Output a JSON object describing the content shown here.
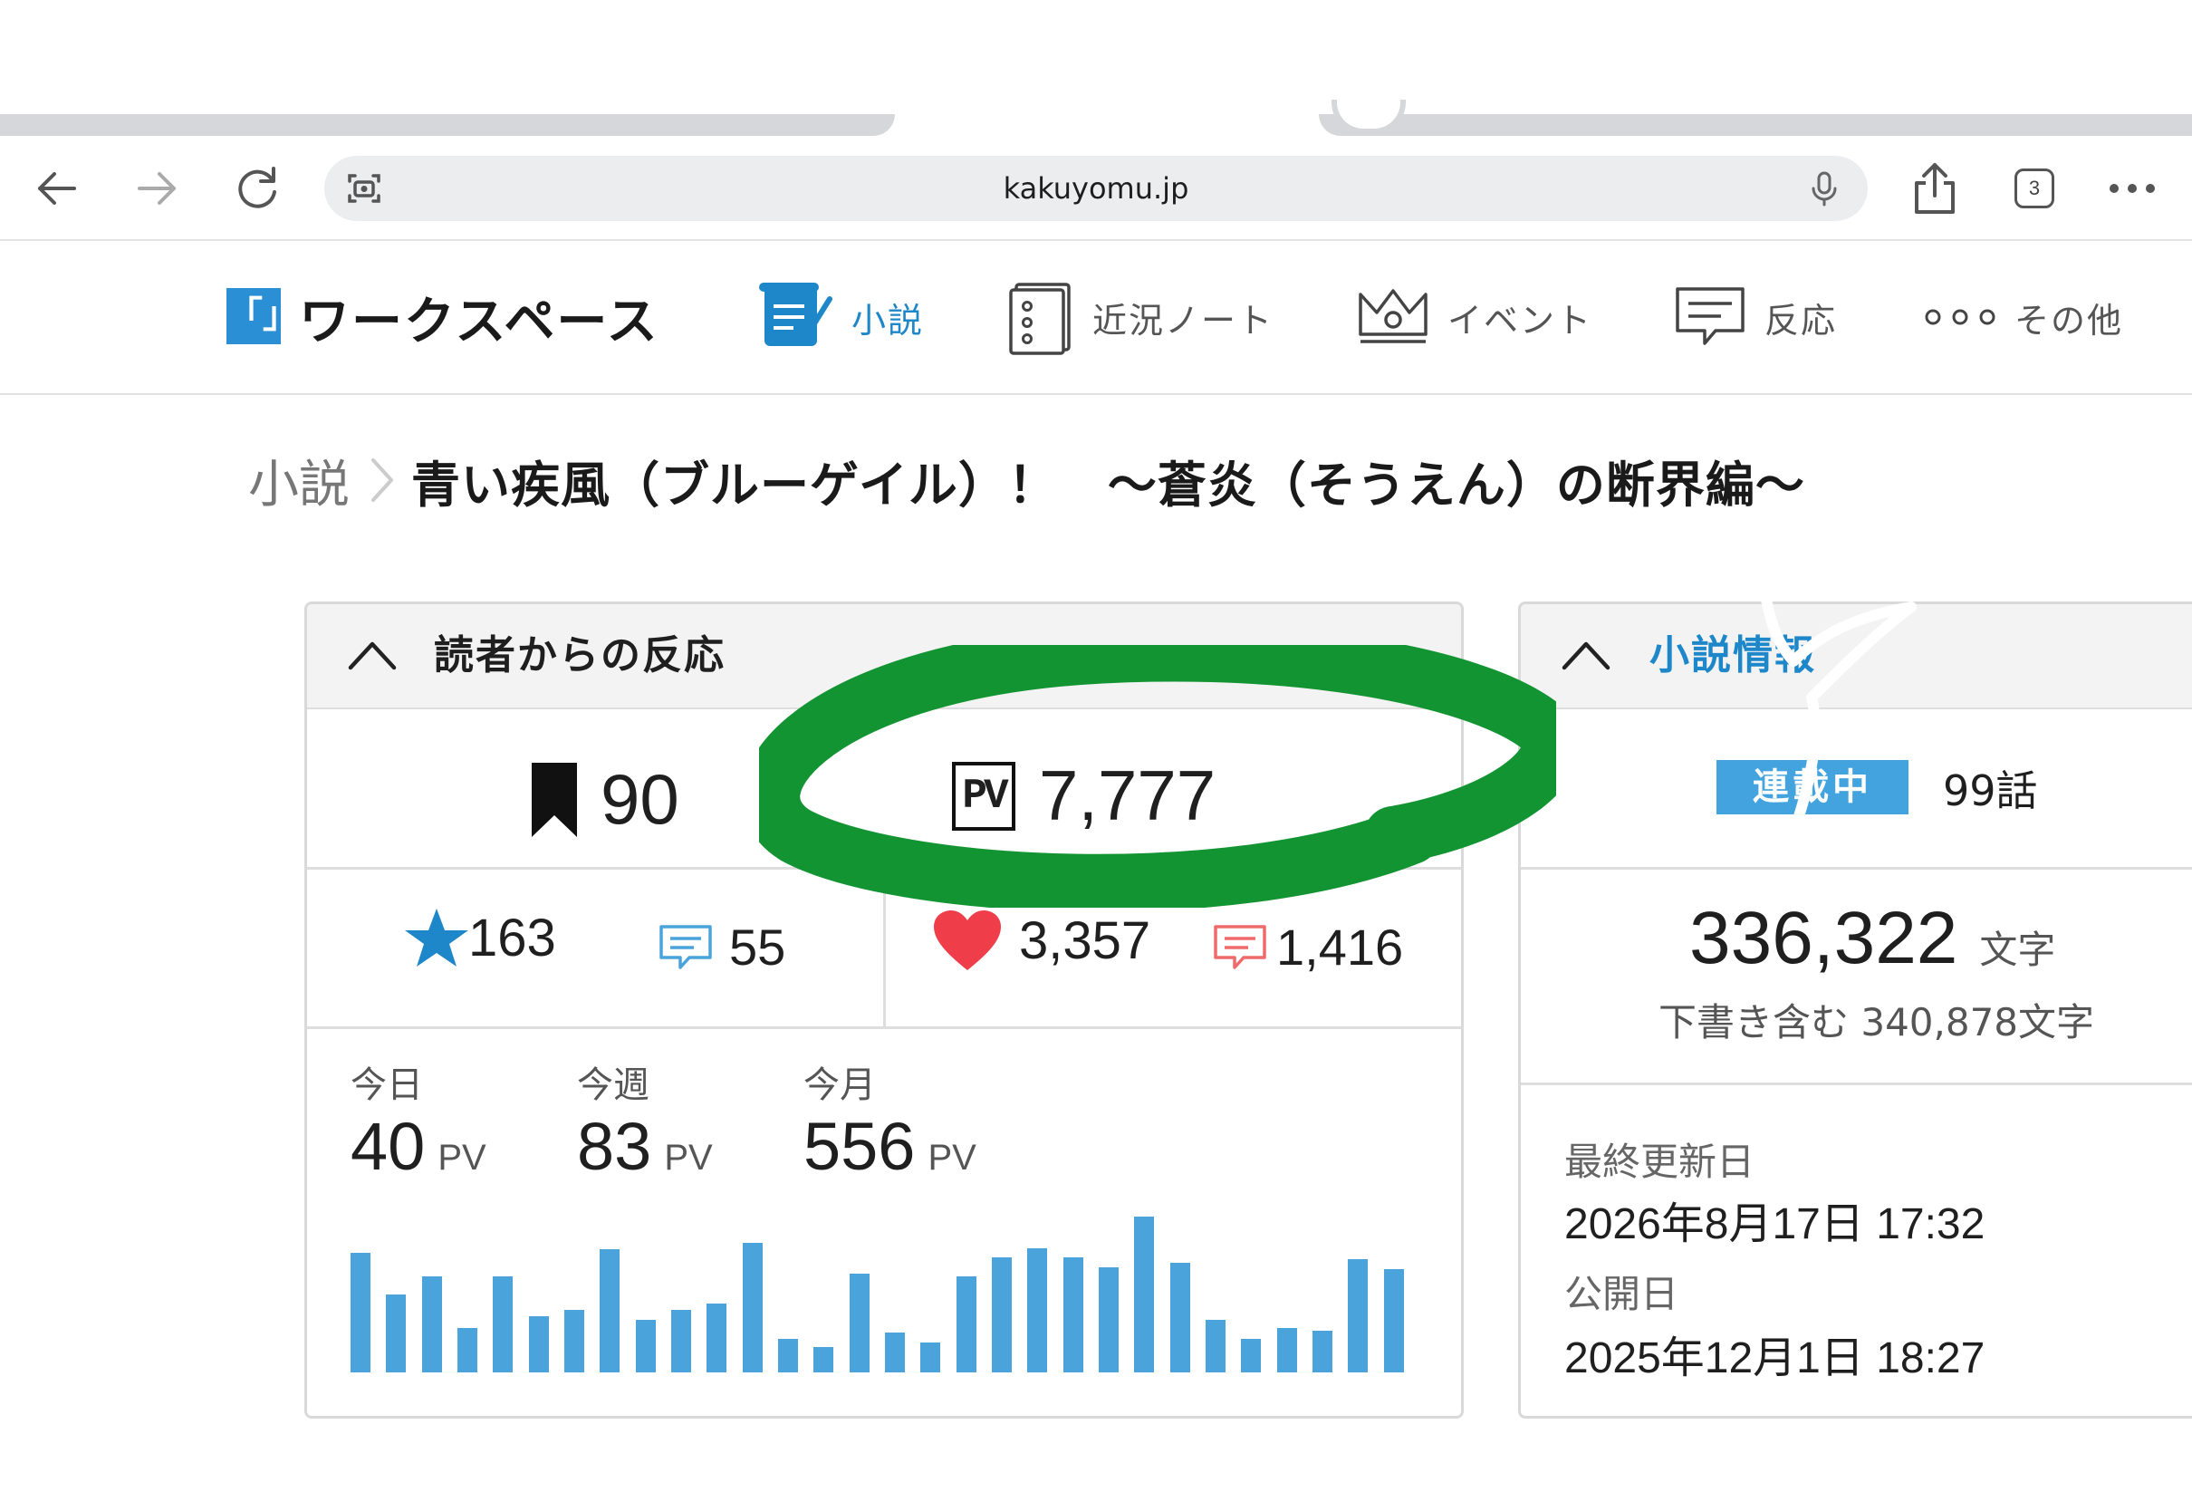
{
  "browser": {
    "url": "kakuyomu.jp",
    "tab_count": "3"
  },
  "header": {
    "logo_text": "「」",
    "title": "ワークスペース",
    "nav": [
      {
        "label": "小説",
        "active": true
      },
      {
        "label": "近況ノート"
      },
      {
        "label": "イベント"
      },
      {
        "label": "反応"
      },
      {
        "label": "その他"
      }
    ]
  },
  "breadcrumb": {
    "root": "小説",
    "title": "青い疾風（ブルーゲイル）！　～蒼炎（そうえん）の断界編～"
  },
  "reactions": {
    "heading": "読者からの反応",
    "bookmarks": "90",
    "pv_badge": "PV",
    "pv_total": "7,777",
    "stars": "163",
    "reviews": "55",
    "hearts": "3,357",
    "comments": "1,416",
    "periods": [
      {
        "label": "今日",
        "value": "40",
        "unit": "PV"
      },
      {
        "label": "今週",
        "value": "83",
        "unit": "PV"
      },
      {
        "label": "今月",
        "value": "556",
        "unit": "PV"
      }
    ]
  },
  "chart_data": {
    "type": "bar",
    "values": [
      0.75,
      0.49,
      0.6,
      0.28,
      0.6,
      0.35,
      0.39,
      0.77,
      0.33,
      0.39,
      0.43,
      0.81,
      0.21,
      0.16,
      0.62,
      0.25,
      0.19,
      0.6,
      0.72,
      0.78,
      0.72,
      0.66,
      0.98,
      0.69,
      0.33,
      0.21,
      0.28,
      0.26,
      0.71,
      0.65
    ],
    "color": "#4aa3db"
  },
  "info": {
    "heading": "小説情報",
    "status": "連載中",
    "episodes": "99話",
    "char_count": "336,322",
    "char_unit": "文字",
    "draft_note": "下書き含む 340,878文字",
    "updated_label": "最終更新日",
    "updated_value": "2026年8月17日 17:32",
    "published_label": "公開日",
    "published_value": "2025年12月1日 18:27"
  },
  "colors": {
    "accent": "#1e87c9",
    "marker": "#139432",
    "heart": "#ef3e4a",
    "bar": "#4aa3db"
  }
}
